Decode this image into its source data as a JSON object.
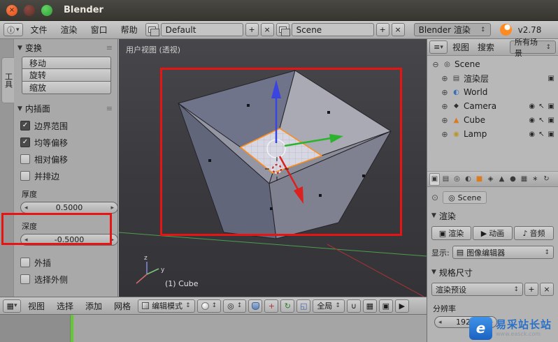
{
  "window": {
    "title": "Blender",
    "version": "v2.78"
  },
  "info_bar": {
    "menus": [
      "文件",
      "渲染",
      "窗口",
      "帮助"
    ],
    "screen_layout": "Default",
    "scene_name": "Scene",
    "engine": "Blender 渲染"
  },
  "tool_shelf": {
    "tab_label": "工具",
    "transform": {
      "title": "变换",
      "move": "移动",
      "rotate": "旋转",
      "scale": "缩放"
    },
    "inset": {
      "title": "内插面",
      "boundary": "边界范围",
      "offset_even": "均等偏移",
      "offset_relative": "相对偏移",
      "edge_rail": "并排边",
      "thickness_label": "厚度",
      "thickness_value": "0.5000",
      "depth_label": "深度",
      "depth_value": "-0.5000",
      "outset": "外插",
      "select_outer": "选择外侧"
    }
  },
  "viewport": {
    "view_label": "用户视图 (透视)",
    "object_info": "(1) Cube",
    "axis_z": "z",
    "axis_y": "y",
    "header": {
      "menus": [
        "视图",
        "选择",
        "添加",
        "网格"
      ],
      "mode": "编辑模式",
      "orientation": "全局"
    }
  },
  "outliner": {
    "menus": [
      "视图",
      "搜索"
    ],
    "display_filter": "所有场景",
    "items": [
      "Scene",
      "渲染层",
      "World",
      "Camera",
      "Cube",
      "Lamp"
    ]
  },
  "properties": {
    "breadcrumb": "Scene",
    "render": {
      "title": "渲染",
      "render_btn": "渲染",
      "animation_btn": "动画",
      "audio_btn": "音频",
      "display_label": "显示:",
      "display_value": "图像编辑器"
    },
    "dimensions": {
      "title": "规格尺寸",
      "preset": "渲染预设",
      "resolution_label": "分辨率",
      "resolution_x": "1920"
    }
  },
  "watermark": {
    "name": "易采站长站",
    "url": "www.easck.com"
  },
  "accent_colors": {
    "annotation": "#e81414",
    "selected_face_outline": "#ff8e1a",
    "axis_x": "#dc1f1f",
    "axis_y": "#2cb22c",
    "axis_z": "#3a44e0"
  },
  "icons": {
    "info": "ⓘ",
    "dropdown": "▾",
    "updown": "↕",
    "plus": "+",
    "close": "×",
    "menu_lines": "≡",
    "panel_open": "▼",
    "check": "✓",
    "arrow_left": "◂",
    "arrow_right": "▸",
    "expander_open": "⊖",
    "expander_closed": "⊕",
    "scene": "◎",
    "layers": "▤",
    "world": "◐",
    "camera_object": "◆",
    "mesh": "▲",
    "lamp": "◉",
    "eye": "◉",
    "pointer": "↖",
    "camera": "▣",
    "editor_grid": "▦",
    "pivot": "◎",
    "translate": "+",
    "rotate": "↻",
    "scale": "◱",
    "magnet": "∪",
    "play": "▶",
    "music": "♪",
    "pin": "⊙",
    "square": "■",
    "diamond": "◈",
    "sphere": "●",
    "star": "∗"
  }
}
